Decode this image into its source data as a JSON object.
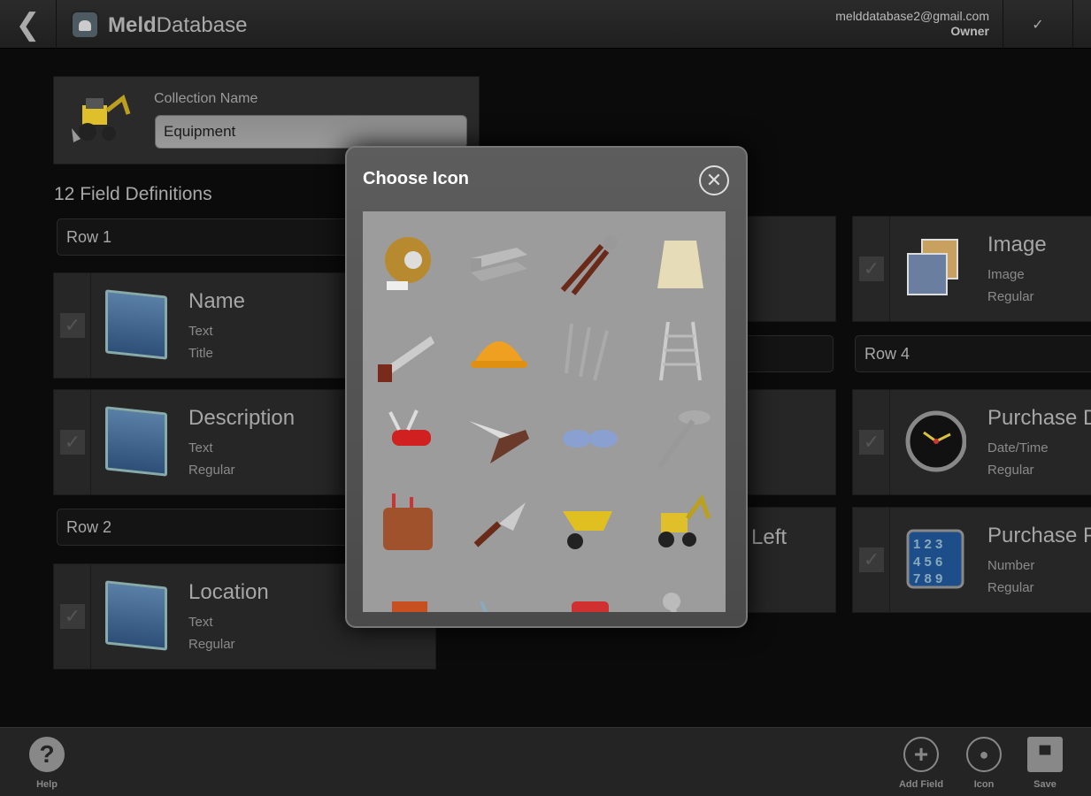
{
  "header": {
    "brand_bold": "Meld",
    "brand_light": "Database",
    "email": "melddatabase2@gmail.com",
    "role": "Owner",
    "back_icon": "chevron-left-icon",
    "confirm_icon": "checkmark-icon",
    "confirm_label": "✓"
  },
  "collection": {
    "label": "Collection Name",
    "value": "Equipment",
    "icon": "backhoe-icon"
  },
  "field_count_label": "12 Field Definitions",
  "rows": [
    {
      "label": "Row 1"
    },
    {
      "label": "Row 2"
    },
    {
      "label": "Row 4"
    }
  ],
  "fields": [
    {
      "title": "Name",
      "type": "Text",
      "style": "Title",
      "icon": "text-document-icon"
    },
    {
      "title": "Description",
      "type": "Text",
      "style": "Regular",
      "icon": "text-document-icon"
    },
    {
      "title": "Location",
      "type": "Text",
      "style": "Regular",
      "icon": "text-document-icon"
    },
    {
      "title": "Left"
    },
    {
      "title": "Image",
      "type": "Image",
      "style": "Regular",
      "icon": "photos-icon"
    },
    {
      "title": "Purchase D",
      "type": "Date/Time",
      "style": "Regular",
      "icon": "clock-icon"
    },
    {
      "title": "Purchase P",
      "type": "Number",
      "style": "Regular",
      "icon": "keypad-icon"
    }
  ],
  "modal": {
    "title": "Choose Icon",
    "close_icon": "close-circle-icon",
    "close_label": "✕",
    "icons": [
      "duct-tape-icon",
      "steel-beam-icon",
      "bolt-cutter-icon",
      "sack-icon",
      "saw-icon",
      "hard-hat-icon",
      "nails-icon",
      "ladder-icon",
      "pocket-knife-icon",
      "folding-knife-icon",
      "safety-glasses-icon",
      "screw-icon",
      "tool-belt-icon",
      "trowel-icon",
      "wheelbarrow-icon",
      "backhoe-icon",
      "forklift-icon",
      "hand-truck-icon",
      "gas-can-icon",
      "wrench-icon"
    ]
  },
  "footer": {
    "help": "Help",
    "add_field": "Add Field",
    "icon": "Icon",
    "save": "Save"
  }
}
